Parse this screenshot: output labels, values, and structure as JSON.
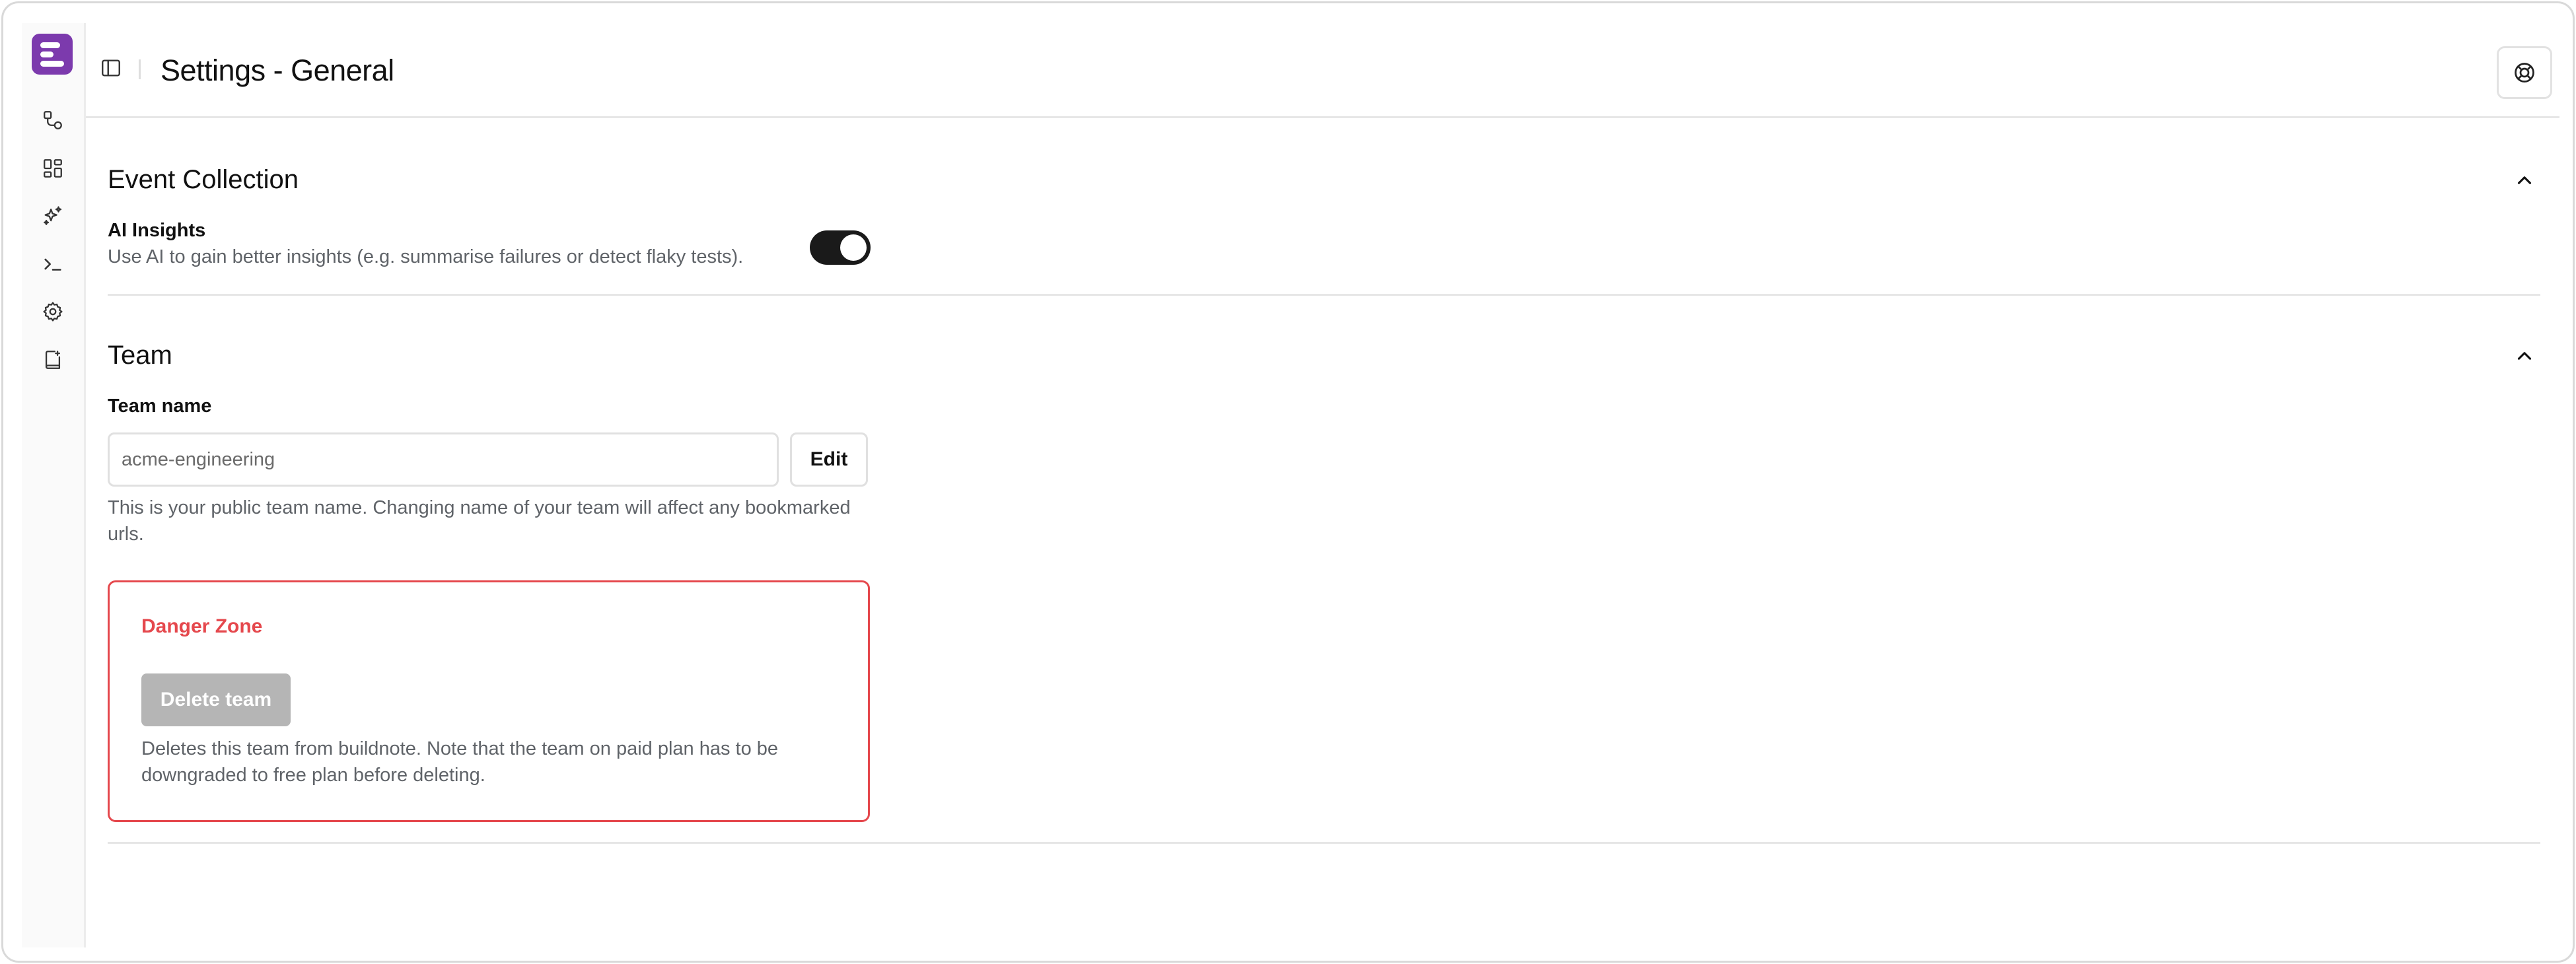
{
  "app": {
    "logo": "buildnote-logo",
    "accent_color": "#7c3aad"
  },
  "sidebar": {
    "items": [
      {
        "name": "workflows",
        "icon": "workflow-icon"
      },
      {
        "name": "dashboard",
        "icon": "dashboard-icon"
      },
      {
        "name": "ai-insights",
        "icon": "sparkles-icon"
      },
      {
        "name": "terminal",
        "icon": "terminal-icon"
      },
      {
        "name": "settings",
        "icon": "gear-icon"
      },
      {
        "name": "docs",
        "icon": "book-icon"
      }
    ]
  },
  "header": {
    "title": "Settings - General",
    "panel_toggle_icon": "sidebar-panel-icon",
    "help_icon": "lifebuoy-icon"
  },
  "event_collection": {
    "title": "Event Collection",
    "ai_insights": {
      "label": "AI Insights",
      "description": "Use AI to gain better insights (e.g. summarise failures or detect flaky tests).",
      "enabled": true
    }
  },
  "team": {
    "title": "Team",
    "team_name_label": "Team name",
    "team_name_value": "acme-engineering",
    "edit_label": "Edit",
    "help_text": "This is your public team name. Changing name of your team will affect any bookmarked urls.",
    "danger_zone": {
      "title": "Danger Zone",
      "delete_label": "Delete team",
      "description": "Deletes this team from buildnote. Note that the team on paid plan has to be downgraded to free plan before deleting.",
      "color": "#e5484d"
    }
  }
}
